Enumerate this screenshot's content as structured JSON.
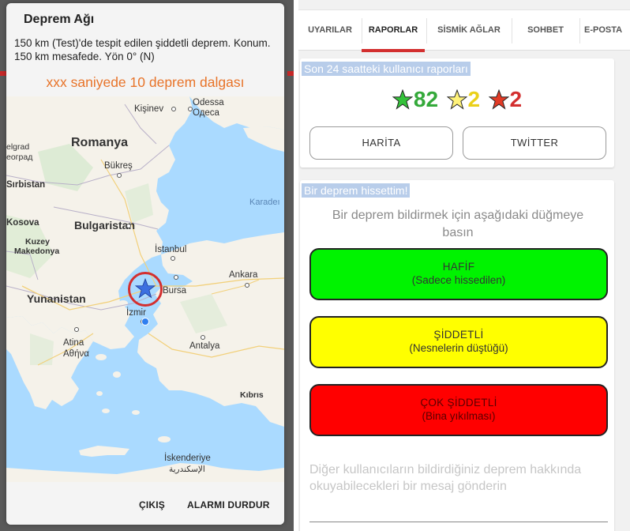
{
  "alert": {
    "title": "Deprem Ağı",
    "message": "150 km (Test)'de tespit edilen şiddetli deprem. Konum. 150 km mesafede. Yön 0° (N)",
    "countdown": "xxx saniyede 10 deprem dalgası",
    "exit_label": "ÇIKIŞ",
    "stop_alarm_label": "ALARMI DURDUR"
  },
  "map": {
    "labels": {
      "odessa": "Odessa",
      "odessa_cyr": "Одеса",
      "kisinev": "Kişinev",
      "romanya": "Romanya",
      "belgrad": "elgrad",
      "belgrad_cyr": "еоград",
      "bukres": "Bükreş",
      "sirbistan": "Sırbistan",
      "karadeniz": "Karadeı",
      "kosova": "Kosova",
      "bulgaristan": "Bulgaristan",
      "kuzey": "Kuzey",
      "makedonya": "Makedonya",
      "istanbul": "İstanbul",
      "ankara": "Ankara",
      "yunanistan": "Yunanistan",
      "bursa": "Bursa",
      "izmir": "İzmir",
      "atina": "Atina",
      "atina_gr": "Αθήνα",
      "antalya": "Antalya",
      "kibris": "Kıbrıs",
      "iskenderiye": "İskenderiye",
      "iskenderiye_ar": "الإسكندرية"
    }
  },
  "tabs": [
    "UYARILAR",
    "RAPORLAR",
    "SİSMİK AĞLAR",
    "SOHBET",
    "E-POSTA"
  ],
  "active_tab": 1,
  "reports": {
    "header": "Son 24 saatteki kullanıcı raporları",
    "green_count": "82",
    "yellow_count": "2",
    "red_count": "2",
    "map_button": "HARİTA",
    "twitter_button": "TWİTTER"
  },
  "feel": {
    "header": "Bir deprem hissettim!",
    "instructions": "Bir deprem bildirmek için aşağıdaki düğmeye basın",
    "light_title": "HAFİF",
    "light_sub": "(Sadece hissedilen)",
    "strong_title": "ŞİDDETLİ",
    "strong_sub": "(Nesnelerin düştüğü)",
    "severe_title": "ÇOK ŞİDDETLİ",
    "severe_sub": "(Bina yıkılması)",
    "message_hint": "Diğer kullanıcıların bildirdiğiniz deprem hakkında okuyabilecekleri bir mesaj gönderin"
  },
  "colors": {
    "accent": "#d32f2f",
    "countdown": "#e8742a",
    "green": "#00f300",
    "yellow": "#ffff00",
    "red": "#ff0000"
  }
}
